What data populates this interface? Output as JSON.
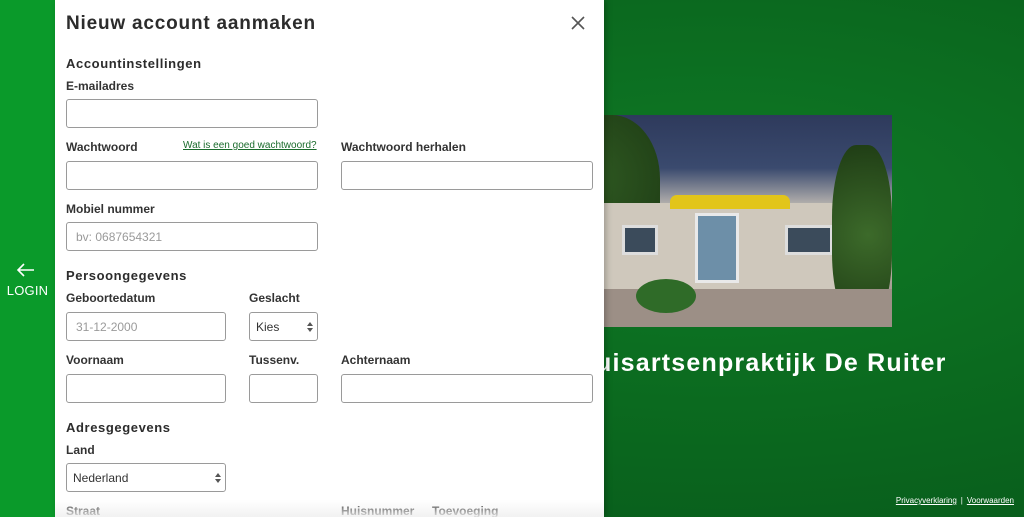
{
  "sidebar": {
    "login_label": "LOGIN",
    "icon": "arrow-left-icon"
  },
  "background": {
    "practice_name": "uisartsenpraktijk De Ruiter",
    "footer": {
      "privacy": "Privacyverklaring",
      "separator": "|",
      "terms": "Voorwaarden"
    }
  },
  "form": {
    "title": "Nieuw account aanmaken",
    "close_icon": "close-icon",
    "account": {
      "heading": "Accountinstellingen",
      "email_label": "E-mailadres",
      "email_value": "",
      "password_label": "Wachtwoord",
      "password_help": "Wat is een goed wachtwoord?",
      "password_repeat_label": "Wachtwoord herhalen",
      "mobile_label": "Mobiel nummer",
      "mobile_placeholder": "bv: 0687654321"
    },
    "personal": {
      "heading": "Persoongegevens",
      "dob_label": "Geboortedatum",
      "dob_placeholder": "31-12-2000",
      "gender_label": "Geslacht",
      "gender_value": "Kies",
      "firstname_label": "Voornaam",
      "infix_label": "Tussenv.",
      "lastname_label": "Achternaam"
    },
    "address": {
      "heading": "Adresgegevens",
      "country_label": "Land",
      "country_value": "Nederland",
      "street_label": "Straat",
      "house_number_label": "Huisnummer",
      "addition_label": "Toevoeging"
    }
  },
  "colors": {
    "brand_green": "#0a9a2a",
    "link_green": "#1a6b2c"
  }
}
